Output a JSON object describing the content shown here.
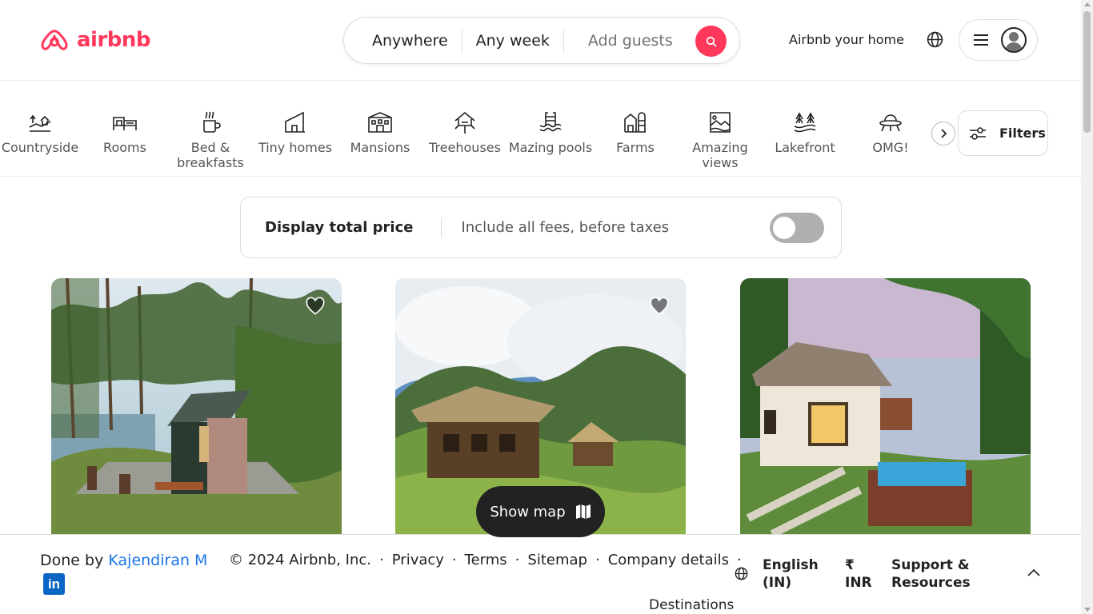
{
  "header": {
    "logo_text": "airbnb",
    "search": {
      "where": "Anywhere",
      "when": "Any week",
      "guests_placeholder": "Add guests"
    },
    "host_link": "Airbnb your home",
    "icons": [
      "airbnb-logo-icon",
      "search-icon",
      "globe-icon",
      "menu-icon",
      "user-icon"
    ]
  },
  "categories": {
    "items": [
      {
        "label": "Countryside",
        "icon": "countryside-icon"
      },
      {
        "label": "Rooms",
        "icon": "rooms-icon"
      },
      {
        "label": "Bed & breakfasts",
        "icon": "bed-breakfast-icon"
      },
      {
        "label": "Tiny homes",
        "icon": "tiny-home-icon"
      },
      {
        "label": "Mansions",
        "icon": "mansion-icon"
      },
      {
        "label": "Treehouses",
        "icon": "treehouse-icon"
      },
      {
        "label": "Mazing pools",
        "icon": "pool-icon"
      },
      {
        "label": "Farms",
        "icon": "farm-icon"
      },
      {
        "label": "Amazing views",
        "icon": "views-icon"
      },
      {
        "label": "Lakefront",
        "icon": "lakefront-icon"
      },
      {
        "label": "OMG!",
        "icon": "ufo-icon"
      }
    ],
    "filters_label": "Filters"
  },
  "price_toggle": {
    "title": "Display total price",
    "subtitle": "Include all fees, before taxes",
    "enabled": false
  },
  "listings": [
    {
      "image": "tiny cabin on hillside with pine trees",
      "favorited": false
    },
    {
      "image": "thatched hut in misty mountains",
      "favorited": false
    },
    {
      "image": "thatched cottage with pool at dusk",
      "favorited": false
    }
  ],
  "show_map": {
    "label": "Show map"
  },
  "footer": {
    "credit_prefix": "Done by",
    "credit_name": "Kajendiran M",
    "linkedin": "in",
    "copyright": "© 2024 Airbnb, Inc.",
    "links": [
      "Privacy",
      "Terms",
      "Sitemap",
      "Company details"
    ],
    "destinations": "Destinations",
    "language_line1": "English",
    "language_line2": "(IN)",
    "currency_symbol": "₹",
    "currency_code": "INR",
    "support_line1": "Support &",
    "support_line2": "Resources"
  },
  "colors": {
    "brand": "#ff385c",
    "text": "#222222",
    "muted": "#717171",
    "map_button": "#222222"
  }
}
